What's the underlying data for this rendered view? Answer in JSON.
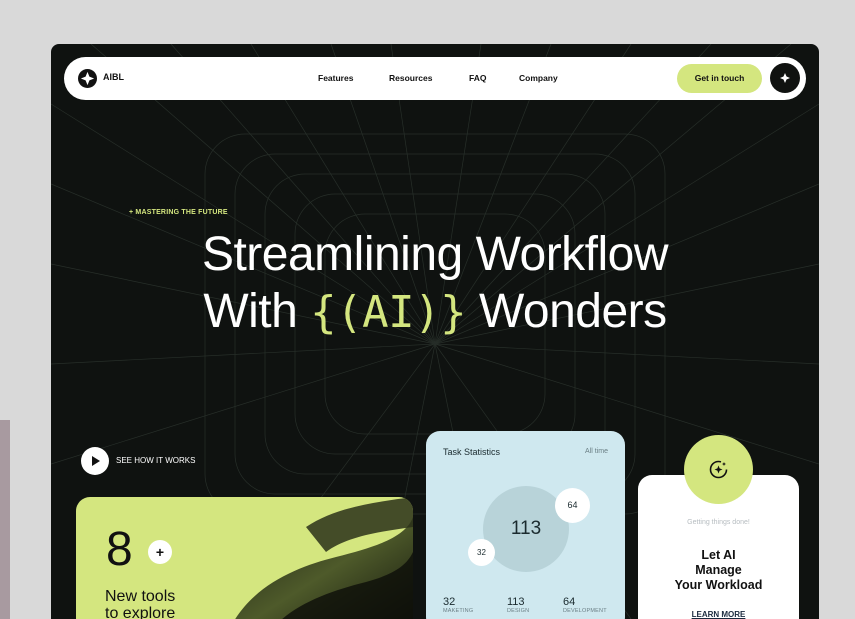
{
  "nav": {
    "brand": "AIBL",
    "links": [
      "Features",
      "Resources",
      "FAQ",
      "Company"
    ],
    "cta": "Get in touch"
  },
  "hero": {
    "eyebrow": "+ MASTERING THE FUTURE",
    "line1": "Streamlining Workflow",
    "line2_before": "With ",
    "line2_accent": "{(AI)}",
    "line2_after": " Wonders"
  },
  "see_how": "SEE HOW IT WORKS",
  "tools_card": {
    "number": "8",
    "plus": "+",
    "line1": "New tools",
    "line2": "to explore"
  },
  "stats_card": {
    "title": "Task Statistics",
    "range": "All time",
    "center": "113",
    "bubble_top": "64",
    "bubble_left": "32",
    "stats": [
      {
        "value": "32",
        "label": "MAKETING"
      },
      {
        "value": "113",
        "label": "DESIGN"
      },
      {
        "value": "64",
        "label": "DEVELOPMENT"
      }
    ]
  },
  "ai_card": {
    "caption": "Getting things done!",
    "title_lines": [
      "Let AI",
      "Manage",
      "Your Workload"
    ],
    "link": "LEARN MORE"
  },
  "colors": {
    "accent": "#d4e67f",
    "dark": "#0f1210",
    "stats_bg": "#cfe8ef"
  }
}
